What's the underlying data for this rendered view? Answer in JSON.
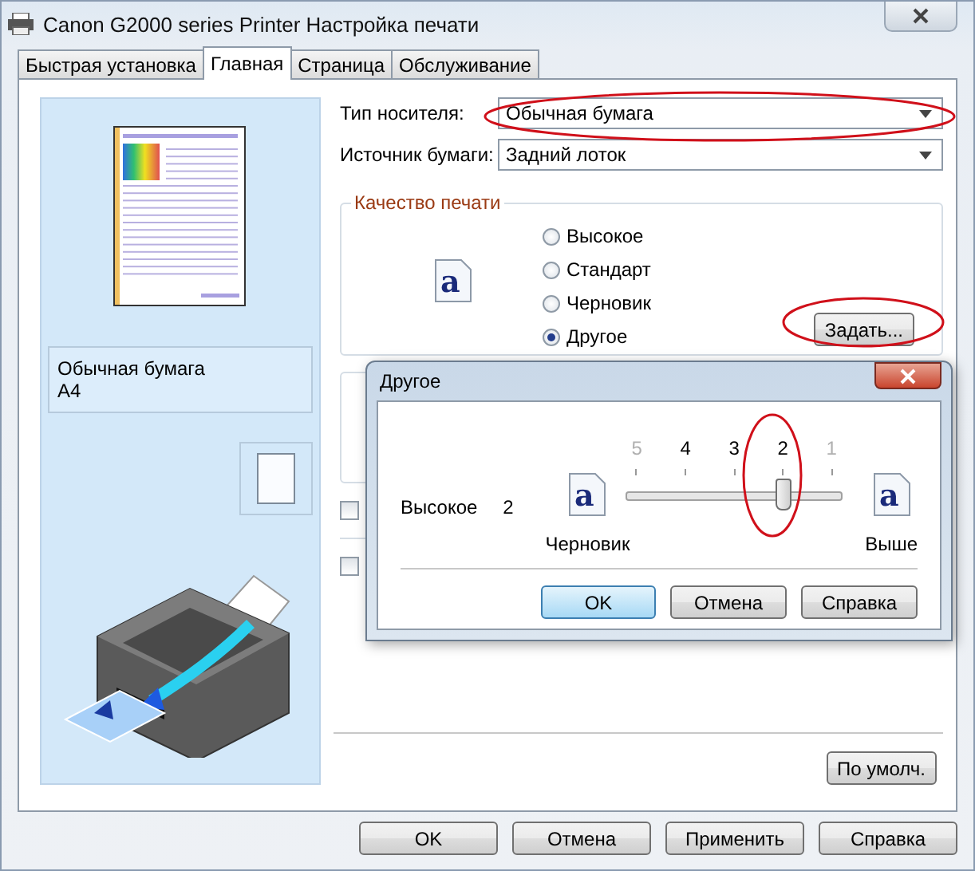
{
  "window": {
    "title": "Canon G2000 series Printer Настройка печати"
  },
  "tabs": [
    {
      "label": "Быстрая установка",
      "selected": false
    },
    {
      "label": "Главная",
      "selected": true
    },
    {
      "label": "Страница",
      "selected": false
    },
    {
      "label": "Обслуживание",
      "selected": false
    }
  ],
  "preview": {
    "media": "Обычная бумага",
    "size": "A4"
  },
  "fields": [
    {
      "label": "Тип носителя:",
      "value": "Обычная бумага"
    },
    {
      "label": "Источник бумаги:",
      "value": "Задний лоток"
    }
  ],
  "quality": {
    "title": "Качество печати",
    "options": [
      {
        "label": "Высокое",
        "selected": false
      },
      {
        "label": "Стандарт",
        "selected": false
      },
      {
        "label": "Черновик",
        "selected": false
      },
      {
        "label": "Другое",
        "selected": true
      }
    ],
    "button": "Задать...",
    "icon_letter": "a"
  },
  "checkboxes": [
    {
      "checked": false
    },
    {
      "checked": false
    }
  ],
  "defaults_button": "По умолч.",
  "dialog": {
    "title": "Другое",
    "quality_label": "Высокое",
    "quality_value": "2",
    "scale": [
      {
        "label": "5",
        "disabled": true
      },
      {
        "label": "4",
        "disabled": false
      },
      {
        "label": "3",
        "disabled": false
      },
      {
        "label": "2",
        "disabled": false
      },
      {
        "label": "1",
        "disabled": true
      }
    ],
    "slider": {
      "level": 0.75
    },
    "left_label": "Черновик",
    "right_label": "Выше",
    "left_icon_letter": "a",
    "right_icon_letter": "a",
    "buttons": [
      {
        "label": "OK",
        "default": true
      },
      {
        "label": "Отмена",
        "default": false
      },
      {
        "label": "Справка",
        "default": false
      }
    ]
  },
  "buttons": [
    "OK",
    "Отмена",
    "Применить",
    "Справка"
  ]
}
